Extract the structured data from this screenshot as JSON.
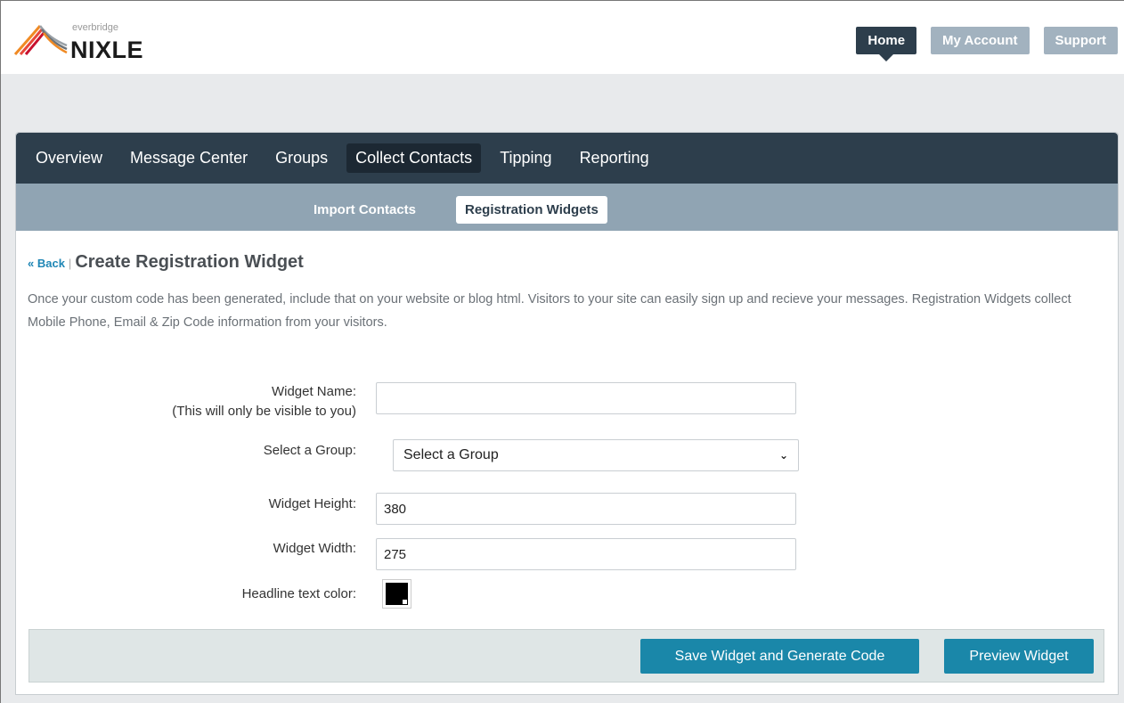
{
  "brand": {
    "small_text": "everbridge",
    "name": "NIXLE"
  },
  "topnav": {
    "items": [
      {
        "label": "Home",
        "active": true
      },
      {
        "label": "My Account",
        "active": false
      },
      {
        "label": "Support",
        "active": false
      }
    ]
  },
  "mainnav": {
    "items": [
      {
        "label": "Overview",
        "active": false
      },
      {
        "label": "Message Center",
        "active": false
      },
      {
        "label": "Groups",
        "active": false
      },
      {
        "label": "Collect Contacts",
        "active": true
      },
      {
        "label": "Tipping",
        "active": false
      },
      {
        "label": "Reporting",
        "active": false
      }
    ]
  },
  "subnav": {
    "items": [
      {
        "label": "Import Contacts",
        "active": false
      },
      {
        "label": "Registration Widgets",
        "active": true
      }
    ]
  },
  "page": {
    "back_label": "« Back",
    "separator": "|",
    "title": "Create Registration Widget",
    "description": "Once your custom code has been generated, include that on your website or blog html. Visitors to your site can easily sign up and recieve your messages. Registration Widgets collect Mobile Phone, Email & Zip Code information from your visitors."
  },
  "form": {
    "widget_name": {
      "label": "Widget Name:",
      "hint": "(This will only be visible to you)",
      "value": ""
    },
    "group": {
      "label": "Select a Group:",
      "selected": "Select a Group"
    },
    "height": {
      "label": "Widget Height:",
      "value": "380"
    },
    "width": {
      "label": "Widget Width:",
      "value": "275"
    },
    "headline_color": {
      "label": "Headline text color:",
      "color": "#000000"
    }
  },
  "actions": {
    "save_label": "Save Widget and Generate Code",
    "preview_label": "Preview Widget"
  },
  "colors": {
    "nav_dark": "#2d3e4c",
    "subnav": "#90a4b3",
    "button": "#1a87a9",
    "link": "#1f86b5"
  }
}
